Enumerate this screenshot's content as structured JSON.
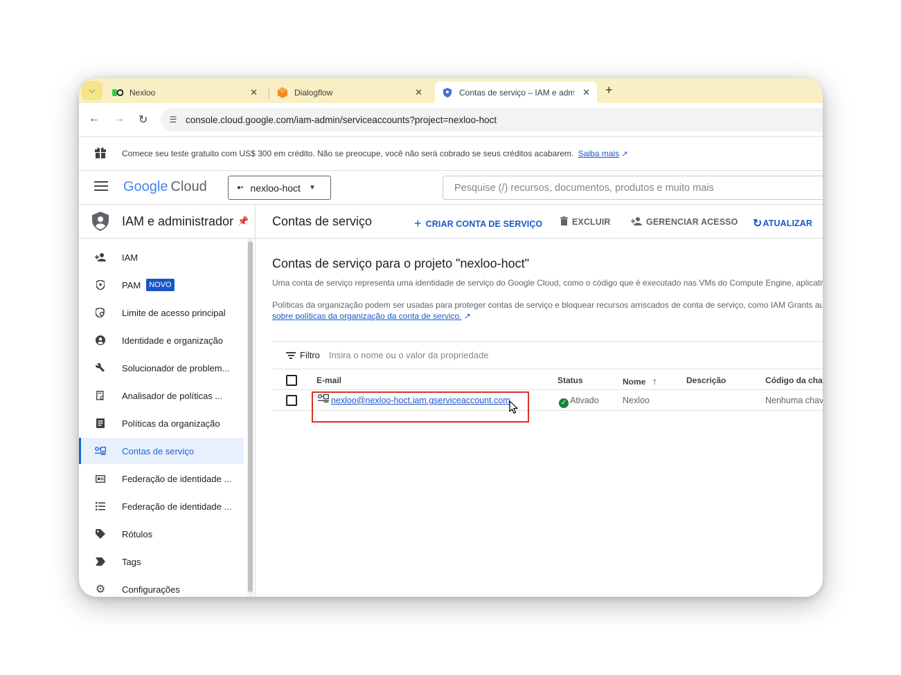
{
  "browser": {
    "tabs": [
      {
        "title": "Nexloo",
        "icon": "nexloo-icon"
      },
      {
        "title": "Dialogflow",
        "icon": "dialogflow-icon"
      },
      {
        "title": "Contas de serviço – IAM e adm",
        "icon": "shield-icon",
        "active": true
      }
    ],
    "url": "console.cloud.google.com/iam-admin/serviceaccounts?project=nexloo-hoct"
  },
  "banner": {
    "text": "Comece seu teste gratuito com US$ 300 em crédito. Não se preocupe, você não será cobrado se seus créditos acabarem.",
    "link": "Saiba mais"
  },
  "header": {
    "logo_google": "Google",
    "logo_cloud": "Cloud",
    "project": "nexloo-hoct",
    "search_placeholder": "Pesquise (/) recursos, documentos, produtos e muito mais"
  },
  "sidebar": {
    "title": "IAM e administrador",
    "items": [
      {
        "label": "IAM",
        "icon": "person-add-icon"
      },
      {
        "label": "PAM",
        "icon": "shield-lock-icon",
        "badge": "NOVO"
      },
      {
        "label": "Limite de acesso principal",
        "icon": "shield-search-icon"
      },
      {
        "label": "Identidade e organização",
        "icon": "account-circle-icon"
      },
      {
        "label": "Solucionador de problem...",
        "icon": "wrench-icon"
      },
      {
        "label": "Analisador de políticas ...",
        "icon": "doc-search-icon"
      },
      {
        "label": "Políticas da organização",
        "icon": "doc-icon"
      },
      {
        "label": "Contas de serviço",
        "icon": "service-account-icon",
        "active": true
      },
      {
        "label": "Federação de identidade ...",
        "icon": "id-card-icon"
      },
      {
        "label": "Federação de identidade ...",
        "icon": "list-icon"
      },
      {
        "label": "Rótulos",
        "icon": "label-icon"
      },
      {
        "label": "Tags",
        "icon": "tag-icon"
      },
      {
        "label": "Configurações",
        "icon": "gear-icon"
      }
    ]
  },
  "main": {
    "title": "Contas de serviço",
    "actions": {
      "create": "CRIAR CONTA DE SERVIÇO",
      "delete": "EXCLUIR",
      "manage": "GERENCIAR ACESSO",
      "refresh": "ATUALIZAR"
    },
    "heading": "Contas de serviço para o projeto \"nexloo-hoct\"",
    "desc1": "Uma conta de serviço representa uma identidade de serviço do Google Cloud, como o código que é executado nas VMs do Compute Engine, aplicativ",
    "desc2": "Políticas da organização podem ser usadas para proteger contas de serviço e bloquear recursos arriscados de conta de serviço, como IAM Grants au",
    "desc2_link": "sobre políticas da organização da conta de serviço.",
    "filter_label": "Filtro",
    "filter_placeholder": "Insira o nome ou o valor da propriedade",
    "columns": {
      "email": "E-mail",
      "status": "Status",
      "name": "Nome",
      "description": "Descrição",
      "key": "Código da chav"
    },
    "rows": [
      {
        "email": "nexloo@nexloo-hoct.iam.gserviceaccount.com",
        "status": "Ativado",
        "name": "Nexloo",
        "description": "",
        "key": "Nenhuma chav"
      }
    ]
  },
  "colors": {
    "accent": "#1a56c9",
    "highlight": "#d93025",
    "tabstrip": "#f8efc4",
    "active_nav_bg": "#e8f0fe",
    "status_ok": "#188038"
  }
}
